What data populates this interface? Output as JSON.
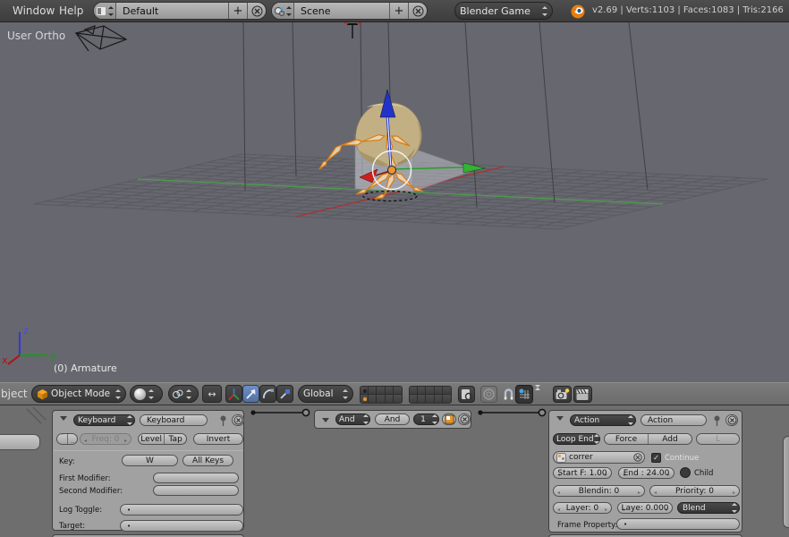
{
  "topbar": {
    "menus": [
      "Window",
      "Help"
    ],
    "screen": {
      "value": "Default"
    },
    "scene": {
      "value": "Scene"
    },
    "engine": {
      "value": "Blender Game"
    },
    "stats": "v2.69 | Verts:1103 | Faces:1083 | Tris:2166"
  },
  "viewport": {
    "view_label": "User Ortho",
    "active_object": "(0) Armature",
    "axes": {
      "x": "x",
      "y": "y",
      "z": "z"
    }
  },
  "vp_header": {
    "menu_clipped": "bject",
    "mode": "Object Mode",
    "orientation": "Global"
  },
  "logic": {
    "sensor": {
      "type": "Keyboard",
      "name": "Keyboard",
      "freq": "Freq: 0",
      "level": "Level",
      "tap": "Tap",
      "invert": "Invert",
      "key_label": "Key:",
      "key_value": "W",
      "all_keys": "All Keys",
      "first_modifier": "First Modifier:",
      "second_modifier": "Second Modifier:",
      "log_toggle": "Log Toggle:",
      "log_value": "•",
      "target": "Target:",
      "target_value": "•"
    },
    "controller": {
      "type": "And",
      "name": "And",
      "state": "1"
    },
    "actuator": {
      "type": "Action",
      "name": "Action",
      "play_mode": "Loop End",
      "force": "Force",
      "add": "Add",
      "l": "L",
      "action_name": "correr",
      "continue_label": "Continue",
      "start": "Start F: 1.00",
      "end": "End : 24.00",
      "child": "Child",
      "blendin": "Blendin: 0",
      "priority": "Priority: 0",
      "layer": "Layer: 0",
      "layer_weight": "Laye: 0.000",
      "blend_mode": "Blend",
      "frame_property_label": "Frame Property:",
      "frame_property_value": "•"
    }
  },
  "colors": {
    "accent_orange": "#e8952e",
    "manip_active": "#5b80b8",
    "axis_x": "#ae3030",
    "axis_y": "#4d9e4d",
    "axis_z": "#2233cc"
  },
  "icons": {
    "screen-layout": "split-square",
    "scene": "balls",
    "blender-logo": "orange-swirl",
    "object-mode": "orange-cube",
    "shading": "sphere",
    "pivot": "circles",
    "manipulator-translate": "axis-tripod",
    "manipulator-move": "arrow",
    "manipulator-rotate": "arc",
    "manipulator-scale": "line-square",
    "magnet": "snap-magnet",
    "camera": "render-camera",
    "clapper": "render-anim",
    "pin": "pushpin",
    "delete": "circle-x"
  }
}
